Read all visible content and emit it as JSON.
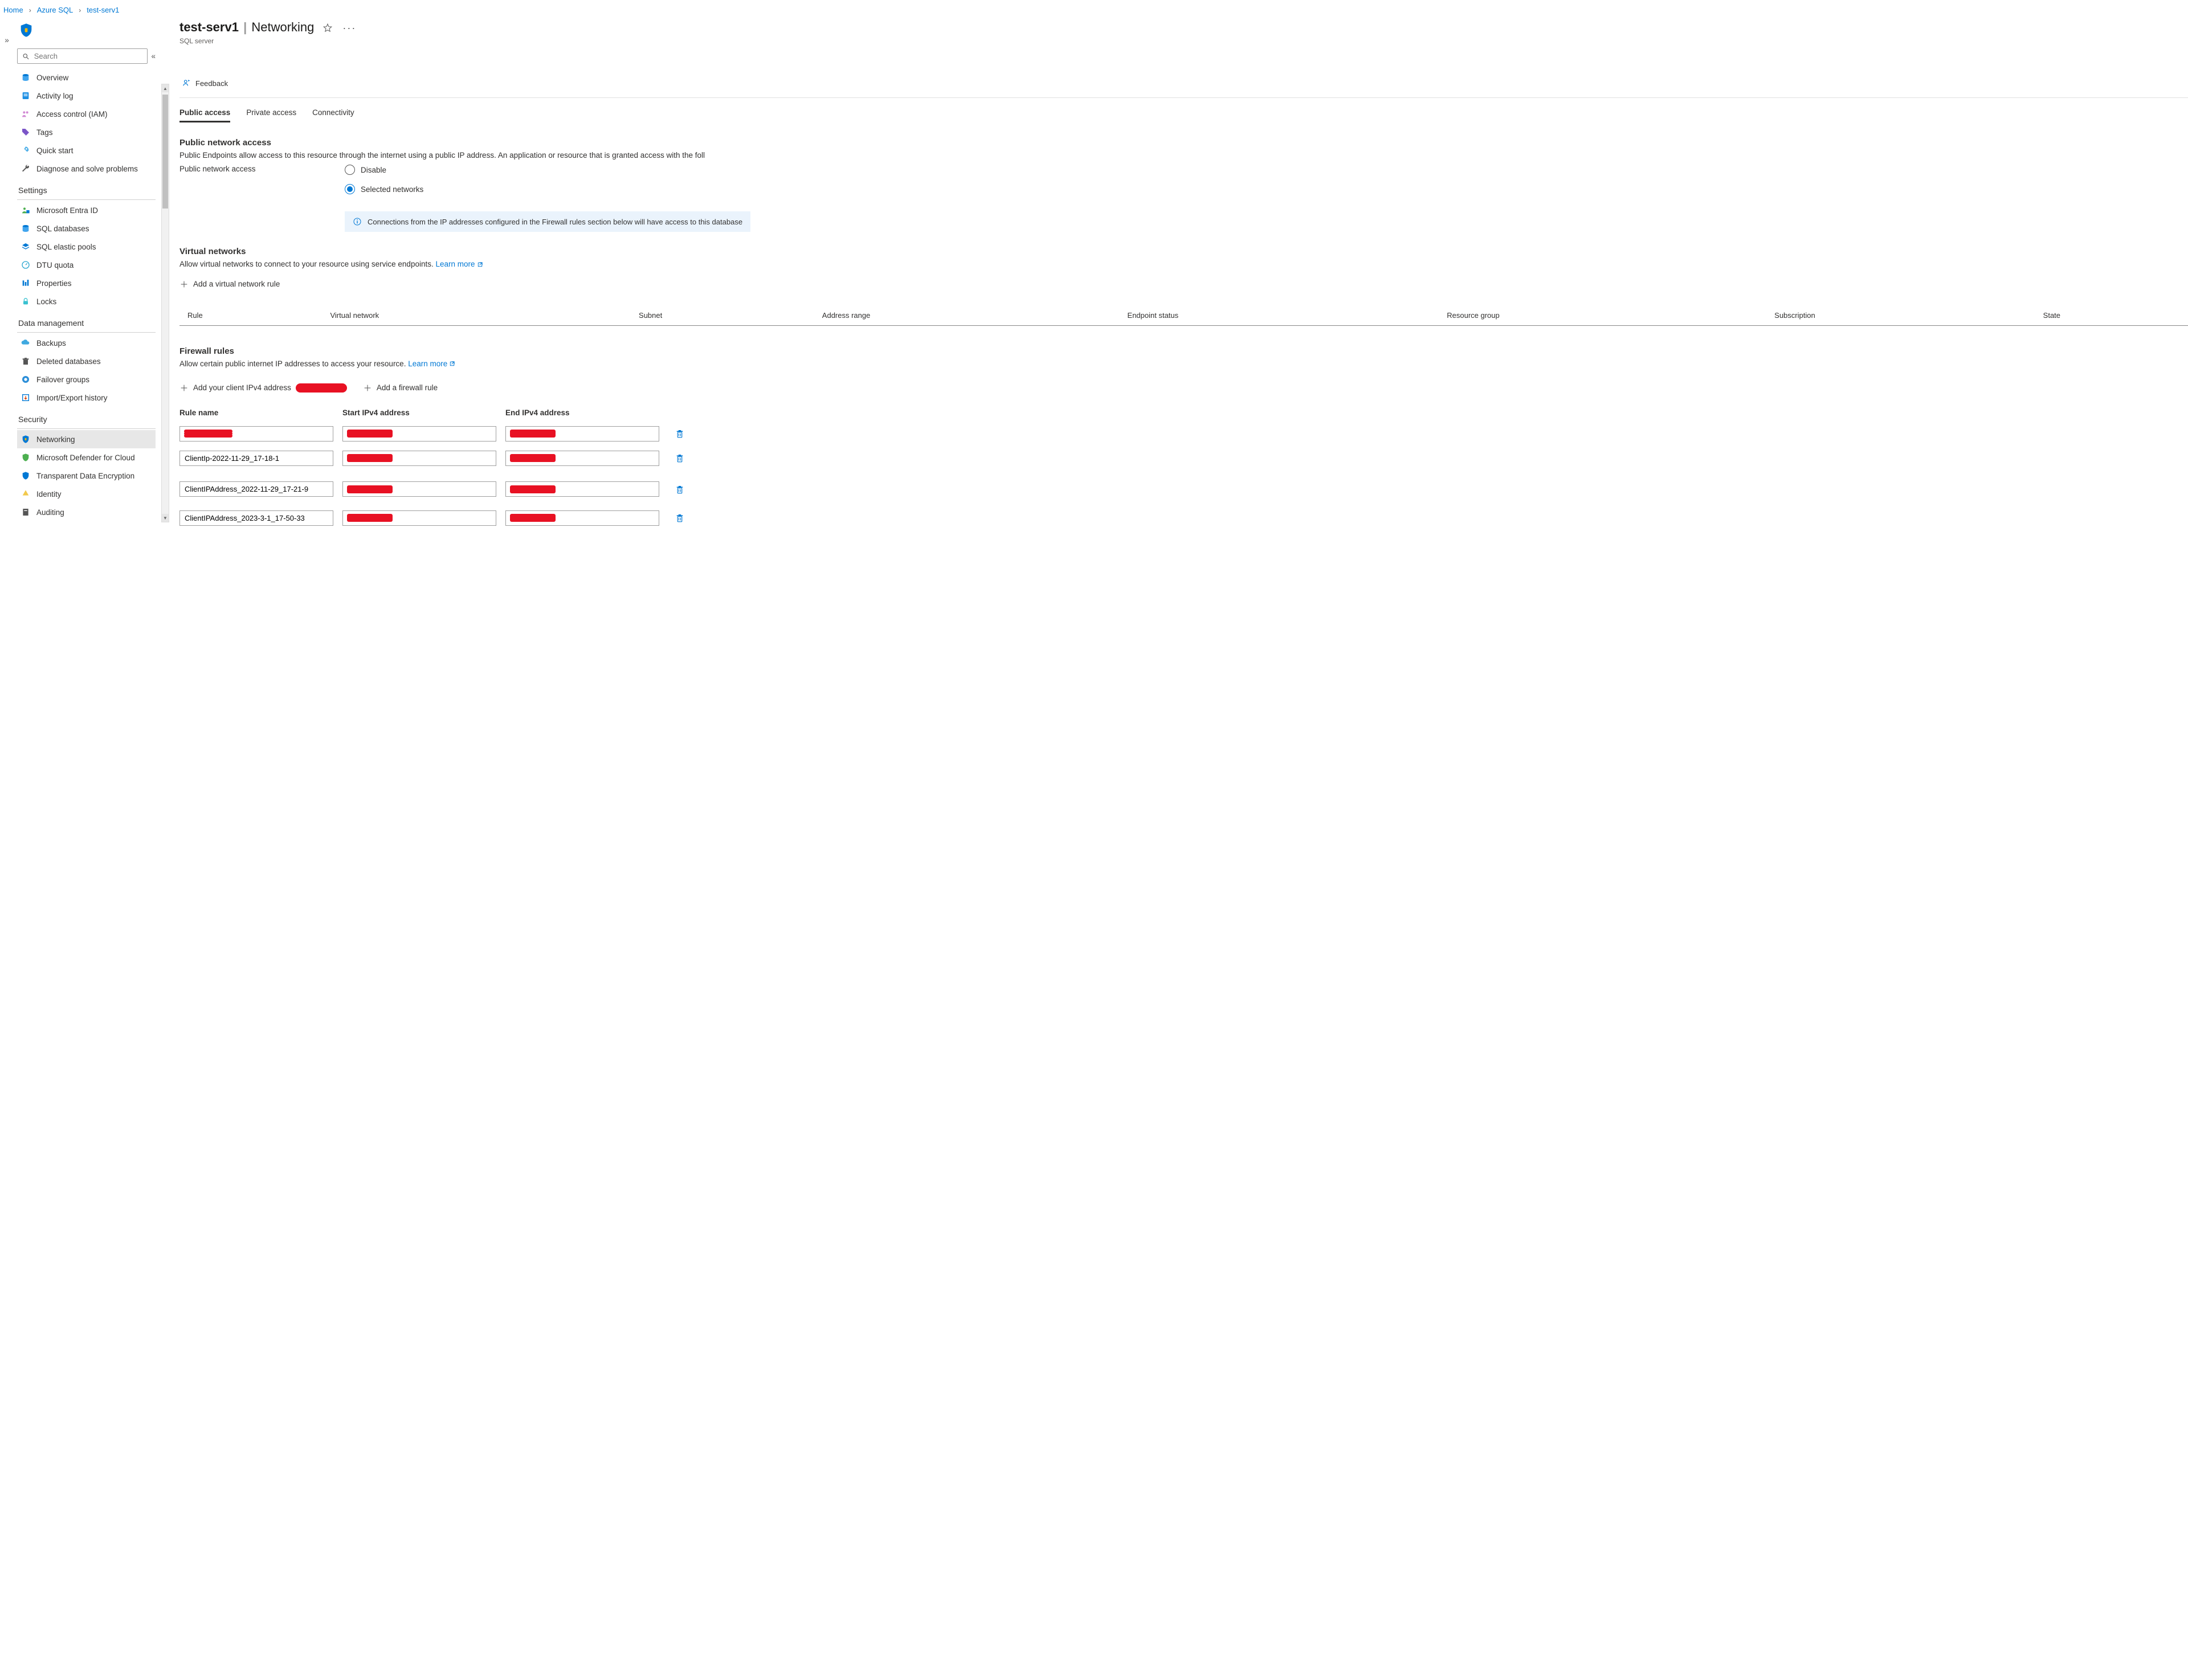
{
  "breadcrumb": [
    "Home",
    "Azure SQL",
    "test-serv1"
  ],
  "header": {
    "resource_name": "test-serv1",
    "section_title": "Networking",
    "resource_type": "SQL server"
  },
  "search": {
    "placeholder": "Search"
  },
  "sidebar": {
    "top": [
      {
        "label": "Overview",
        "icon": "sql-server-icon"
      },
      {
        "label": "Activity log",
        "icon": "activity-icon"
      },
      {
        "label": "Access control (IAM)",
        "icon": "iam-icon"
      },
      {
        "label": "Tags",
        "icon": "tag-icon"
      },
      {
        "label": "Quick start",
        "icon": "quickstart-icon"
      },
      {
        "label": "Diagnose and solve problems",
        "icon": "diagnose-icon"
      }
    ],
    "settings_label": "Settings",
    "settings": [
      {
        "label": "Microsoft Entra ID",
        "icon": "entra-icon"
      },
      {
        "label": "SQL databases",
        "icon": "database-icon"
      },
      {
        "label": "SQL elastic pools",
        "icon": "elastic-icon"
      },
      {
        "label": "DTU quota",
        "icon": "dtu-icon"
      },
      {
        "label": "Properties",
        "icon": "properties-icon"
      },
      {
        "label": "Locks",
        "icon": "lock-icon"
      }
    ],
    "data_label": "Data management",
    "data": [
      {
        "label": "Backups",
        "icon": "backup-icon"
      },
      {
        "label": "Deleted databases",
        "icon": "trash-icon"
      },
      {
        "label": "Failover groups",
        "icon": "failover-icon"
      },
      {
        "label": "Import/Export history",
        "icon": "import-icon"
      }
    ],
    "security_label": "Security",
    "security": [
      {
        "label": "Networking",
        "icon": "shield-icon",
        "selected": true
      },
      {
        "label": "Microsoft Defender for Cloud",
        "icon": "defender-icon"
      },
      {
        "label": "Transparent Data Encryption",
        "icon": "tde-icon"
      },
      {
        "label": "Identity",
        "icon": "identity-icon"
      },
      {
        "label": "Auditing",
        "icon": "auditing-icon"
      }
    ]
  },
  "commands": {
    "feedback": "Feedback"
  },
  "tabs": [
    "Public access",
    "Private access",
    "Connectivity"
  ],
  "public_access": {
    "heading": "Public network access",
    "desc": "Public Endpoints allow access to this resource through the internet using a public IP address. An application or resource that is granted access with the foll",
    "radio_label": "Public network access",
    "options": {
      "disable": "Disable",
      "selected": "Selected networks"
    },
    "info": "Connections from the IP addresses configured in the Firewall rules section below will have access to this database"
  },
  "vnet": {
    "heading": "Virtual networks",
    "desc": "Allow virtual networks to connect to your resource using service endpoints. ",
    "learn_more": "Learn more",
    "add_label": "Add a virtual network rule",
    "columns": [
      "Rule",
      "Virtual network",
      "Subnet",
      "Address range",
      "Endpoint status",
      "Resource group",
      "Subscription",
      "State"
    ]
  },
  "firewall": {
    "heading": "Firewall rules",
    "desc": "Allow certain public internet IP addresses to access your resource. ",
    "learn_more": "Learn more",
    "add_client_label": "Add your client IPv4 address ",
    "add_rule_label": "Add a firewall rule",
    "columns": {
      "name": "Rule name",
      "start": "Start IPv4 address",
      "end": "End IPv4 address"
    },
    "rules": [
      {
        "name": "",
        "redacted": true,
        "start_redacted": true,
        "end_redacted": true
      },
      {
        "name": "ClientIp-2022-11-29_17-18-1",
        "start_redacted": true,
        "end_redacted": true
      },
      {
        "name": "ClientIPAddress_2022-11-29_17-21-9",
        "start_redacted": true,
        "end_redacted": true,
        "highlight": true
      },
      {
        "name": "ClientIPAddress_2023-3-1_17-50-33",
        "start_redacted": true,
        "end_redacted": true
      }
    ]
  }
}
